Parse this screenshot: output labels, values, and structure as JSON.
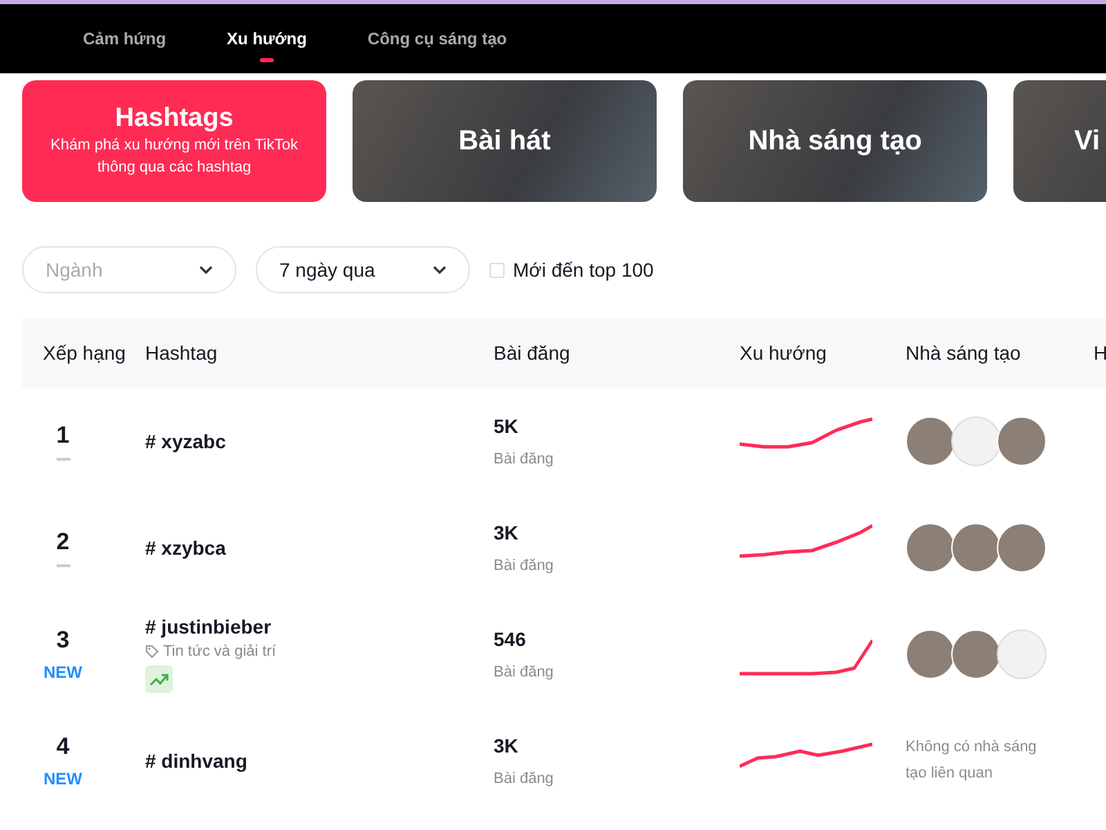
{
  "nav": {
    "items": [
      {
        "label": "Cảm hứng",
        "selected": false
      },
      {
        "label": "Xu hướng",
        "selected": true
      },
      {
        "label": "Công cụ sáng tạo",
        "selected": false
      }
    ]
  },
  "categories": [
    {
      "title": "Hashtags",
      "subtitle": "Khám phá xu hướng mới trên TikTok thông qua các hashtag",
      "selected": true
    },
    {
      "title": "Bài hát",
      "selected": false
    },
    {
      "title": "Nhà sáng tạo",
      "selected": false
    },
    {
      "title": "Vi",
      "selected": false
    }
  ],
  "filters": {
    "industry": {
      "placeholder": "Ngành"
    },
    "period": {
      "value": "7 ngày qua"
    },
    "new_to_top": {
      "label": "Mới đến top 100",
      "checked": false
    }
  },
  "table": {
    "columns": [
      "Xếp hạng",
      "Hashtag",
      "Bài đăng",
      "Xu hướng",
      "Nhà sáng tạo",
      "H"
    ],
    "rows": [
      {
        "rank": "1",
        "kind": "unchanged",
        "hashtag": "# xyzabc",
        "rising_badge": false,
        "posts": "5K",
        "posts_label": "Bài đăng",
        "creators": [
          {
            "kind": "photo"
          },
          {
            "kind": "logo"
          },
          {
            "kind": "photo"
          }
        ]
      },
      {
        "rank": "2",
        "kind": "unchanged",
        "hashtag": "# xzybca",
        "rising_badge": false,
        "posts": "3K",
        "posts_label": "Bài đăng",
        "creators": [
          {
            "kind": "photo"
          },
          {
            "kind": "photo"
          },
          {
            "kind": "photo"
          }
        ]
      },
      {
        "rank": "3",
        "kind": "new",
        "status_label": "NEW",
        "hashtag": "# justinbieber",
        "category": "Tin tức và giải trí",
        "rising_badge": true,
        "posts": "546",
        "posts_label": "Bài đăng",
        "creators": [
          {
            "kind": "photo"
          },
          {
            "kind": "photo"
          },
          {
            "kind": "logo"
          }
        ]
      },
      {
        "rank": "4",
        "kind": "new",
        "status_label": "NEW",
        "hashtag": "# dinhvang",
        "rising_badge": false,
        "posts": "3K",
        "posts_label": "Bài đăng",
        "no_creators": "Không có nhà sáng tạo liên quan"
      }
    ]
  }
}
